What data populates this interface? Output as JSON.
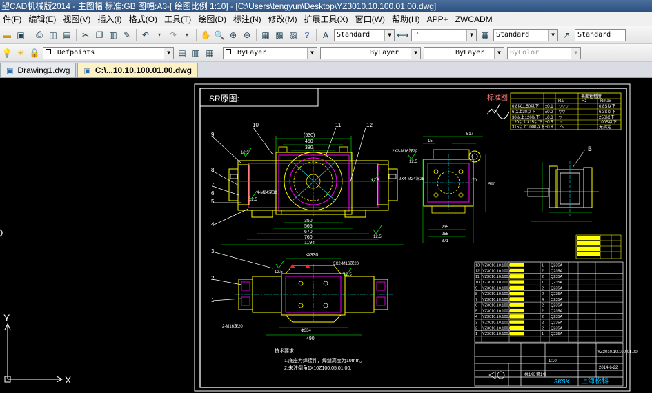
{
  "window": {
    "title": "望CAD机械版2014 - 主图幅  标准:GB 图幅:A3-[ 绘图比例 1:10] - [C:\\Users\\tengyun\\Desktop\\YZ3010.10.100.01.00.dwg]"
  },
  "menu": {
    "items": [
      "件(F)",
      "编辑(E)",
      "视图(V)",
      "插入(I)",
      "格式(O)",
      "工具(T)",
      "绘图(D)",
      "标注(N)",
      "修改(M)",
      "扩展工具(X)",
      "窗口(W)",
      "帮助(H)",
      "APP+",
      "ZWCADM"
    ]
  },
  "toolbar1": {
    "text_style": "Standard",
    "dim_style": "P",
    "table_style": "Standard",
    "multileader_style": "Standard"
  },
  "toolbar2": {
    "layer": "Defpoints",
    "color": "ByLayer",
    "linetype": "ByLayer",
    "lineweight": "ByLayer",
    "plotstyle": "ByColor"
  },
  "tabs": [
    {
      "label": "Drawing1.dwg",
      "active": false
    },
    {
      "label": "C:\\...10.10.100.01.00.dwg",
      "active": true
    }
  ],
  "drawing": {
    "view_label": "SR原图:",
    "standard_label": "标准图",
    "balloons": [
      "10",
      "11",
      "12",
      "9",
      "8",
      "7",
      "6",
      "5",
      "4",
      "3",
      "2",
      "1",
      "B"
    ],
    "dims_front": [
      "(530)",
      "450",
      "380",
      "350",
      "565",
      "670",
      "760",
      "1194"
    ],
    "dims_side": [
      "517",
      "15",
      "2X2-M16深20",
      "235",
      "255",
      "371",
      "590",
      "170"
    ],
    "dims_bottom": [
      "Φ330",
      "Φ334",
      "490",
      "3X2-M16深20"
    ],
    "roughness_marks": [
      "12.5",
      "12.5",
      "12.5",
      "12.5",
      "12.5",
      "12.5",
      "12.5"
    ],
    "tech_req_title": "技术要求:",
    "tech_req_lines": [
      "1.底座为焊接件，焊缝高度为10mm。",
      "2.未注倒角1X10Z100.05.01.00."
    ],
    "company_name": "上海松科",
    "roughness_table_header": [
      "表面粗糙度",
      "Ra",
      "Rz",
      "Rmax"
    ],
    "roughness_table_rows": [
      [
        "0.8以上50以下",
        "±0.1",
        "▽▽▽",
        "0.8S以下"
      ],
      [
        "6以上30以下",
        "±0.2",
        "▽▽",
        "6.3S以下"
      ],
      [
        "30以上120以下",
        "±0.3",
        "▽",
        "25S以下"
      ],
      [
        "120以上315以下",
        "±0.5",
        "~",
        "100S以下"
      ],
      [
        "315以上1000以下",
        "±0.8",
        "～",
        "无指定"
      ]
    ],
    "bom_rows": [
      [
        "13",
        "YZ3010.10.100.01-13",
        "1",
        "Q235A"
      ],
      [
        "12",
        "YZ3010.10.100.01-12",
        "2",
        "Q235A"
      ],
      [
        "11",
        "YZ3010.10.100.01-11",
        "2",
        "Q235A"
      ],
      [
        "10",
        "YZ3010.10.100.01-10",
        "1",
        "Q235A"
      ],
      [
        "9",
        "YZ3010.10.100.01-09",
        "2",
        "Q235A"
      ],
      [
        "8",
        "YZ3010.10.100.01-08",
        "2",
        "Q235A"
      ],
      [
        "7",
        "YZ3010.10.100.01-07",
        "4",
        "Q235A"
      ],
      [
        "6",
        "YZ3010.10.100.01-06",
        "2",
        "Q235A"
      ],
      [
        "5",
        "YZ3010.10.100.01-05",
        "2",
        "Q235A"
      ],
      [
        "4",
        "YZ3010.10.100.01-04",
        "2",
        "Q235A"
      ],
      [
        "3",
        "YZ3010.10.100.01-03",
        "2",
        "Q235A"
      ],
      [
        "2",
        "YZ3010.10.100.01-02",
        "2",
        "Q235A"
      ],
      [
        "1",
        "YZ3010.10.100.01-01",
        "1",
        "Q235A"
      ]
    ],
    "title_block": {
      "drawing_no": "YZ3010.10.100.01.00",
      "scale": "1:10",
      "date": "2014-6-22",
      "sheet": "共1张 第1张"
    }
  },
  "ucs": {
    "x_label": "X",
    "y_label": "Y"
  },
  "colors": {
    "titlebar": "#2b4f7e",
    "canvas_bg": "#000000",
    "yellow_lines": "#ffff00",
    "magenta_lines": "#ff00ff",
    "cyan_lines": "#00ffff",
    "green_lines": "#00ff00",
    "white_lines": "#ffffff",
    "red": "#ff2020"
  }
}
